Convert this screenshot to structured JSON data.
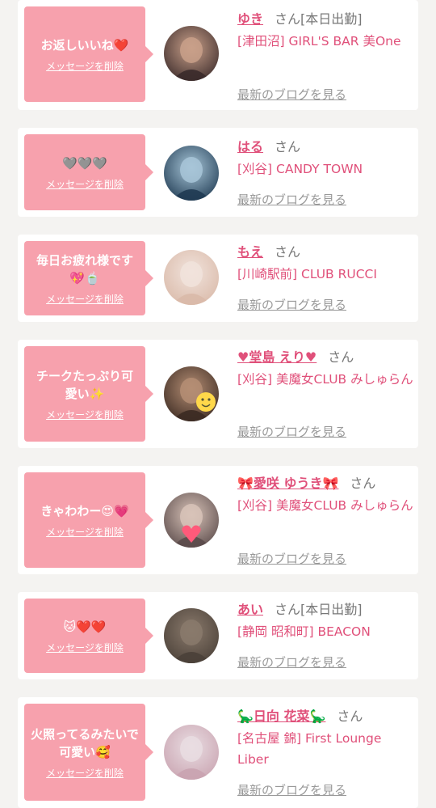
{
  "entries": [
    {
      "message": "お返しいいね❤️",
      "delete_label": "メッセージを削除",
      "name": "ゆき",
      "san": "さん",
      "status": "[本日出勤]",
      "shop": "[津田沼] GIRL'S BAR 美One",
      "blog_label": "最新のブログを見る",
      "avatar_icon": "avatar-photo",
      "avatar_colors": [
        "#3a2a2a",
        "#c9a08a"
      ]
    },
    {
      "message": "🩶🩶🩶",
      "delete_label": "メッセージを削除",
      "name": "はる",
      "san": "さん",
      "status": "",
      "shop": "[刈谷] CANDY TOWN",
      "blog_label": "最新のブログを見る",
      "avatar_icon": "avatar-photo",
      "avatar_colors": [
        "#1f3a52",
        "#a8c6d8"
      ]
    },
    {
      "message": "毎日お疲れ様です💖🍵",
      "delete_label": "メッセージを削除",
      "name": "もえ",
      "san": "さん",
      "status": "",
      "shop": "[川崎駅前] CLUB RUCCI",
      "blog_label": "最新のブログを見る",
      "avatar_icon": "avatar-photo",
      "avatar_colors": [
        "#d9b9a8",
        "#f1e3dc"
      ]
    },
    {
      "message": "チークたっぷり可愛い✨",
      "delete_label": "メッセージを削除",
      "name": "♥堂島 えり♥",
      "san": "さん",
      "status": "",
      "shop": "[刈谷] 美魔女CLUB みしゅらん",
      "blog_label": "最新のブログを見る",
      "avatar_icon": "avatar-photo-smiley",
      "avatar_colors": [
        "#3b2a22",
        "#b58e74"
      ]
    },
    {
      "message": "きゃわわー😍💗",
      "delete_label": "メッセージを削除",
      "name": "🎀愛咲 ゆうき🎀",
      "san": "さん",
      "status": "",
      "shop": "[刈谷] 美魔女CLUB みしゅらん",
      "blog_label": "最新のブログを見る",
      "avatar_icon": "avatar-photo-heart",
      "avatar_colors": [
        "#5a4a4a",
        "#d8c3b8"
      ]
    },
    {
      "message": "🐱❤️❤️",
      "delete_label": "メッセージを削除",
      "name": "あい",
      "san": "さん",
      "status": "[本日出勤]",
      "shop": "[静岡 昭和町] BEACON",
      "blog_label": "最新のブログを見る",
      "avatar_icon": "avatar-photo",
      "avatar_colors": [
        "#4a4038",
        "#8a7a6c"
      ]
    },
    {
      "message": "火照ってるみたいで可愛い🥰",
      "delete_label": "メッセージを削除",
      "name": "🦕日向 花菜🦕",
      "san": "さん",
      "status": "",
      "shop": "[名古屋 錦] First Lounge Liber",
      "blog_label": "最新のブログを見る",
      "avatar_icon": "avatar-photo",
      "avatar_colors": [
        "#c9a3b0",
        "#e9dde2"
      ]
    }
  ]
}
